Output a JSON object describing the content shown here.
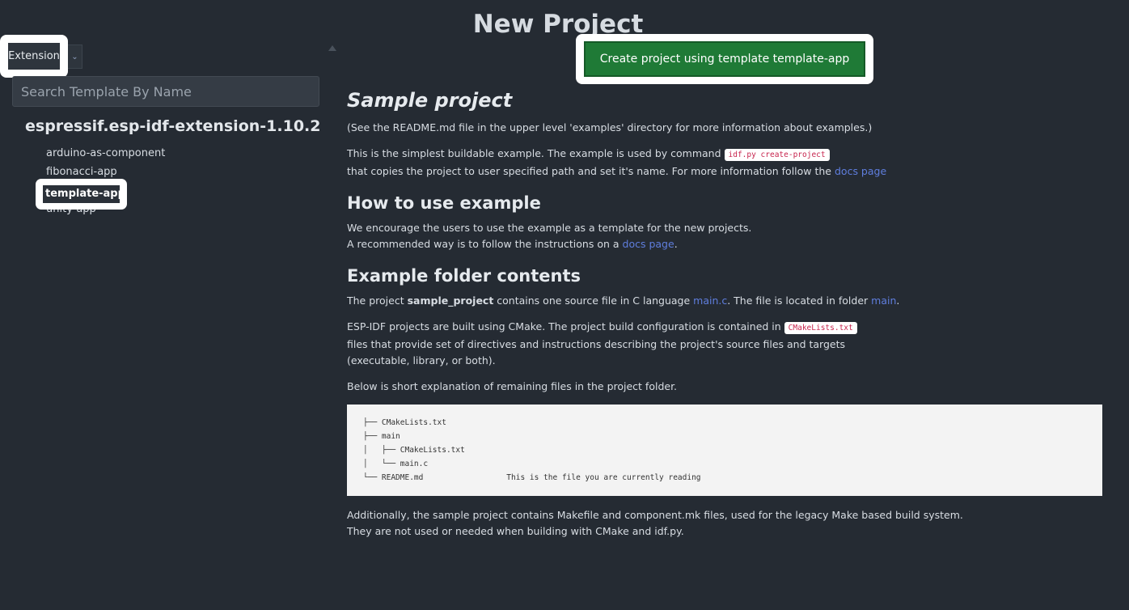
{
  "title": "New Project",
  "source_select": {
    "value": "Extension"
  },
  "search": {
    "placeholder": "Search Template By Name"
  },
  "group": "espressif.esp-idf-extension-1.10.2",
  "templates": [
    "arduino-as-component",
    "fibonacci-app",
    "template-app",
    "unity-app"
  ],
  "create_button": "Create project using template template-app",
  "readme": {
    "h1": "Sample project",
    "p1": "(See the README.md file in the upper level 'examples' directory for more information about examples.)",
    "p2a": "This is the simplest buildable example. The example is used by command ",
    "p2_code": "idf.py create-project",
    "p2b": "that copies the project to user specified path and set it's name. For more information follow the ",
    "p2_link": "docs page",
    "h2a": "How to use example",
    "p3a": "We encourage the users to use the example as a template for the new projects.",
    "p3b": "A recommended way is to follow the instructions on a ",
    "p3_link": "docs page",
    "p3_end": ".",
    "h2b": "Example folder contents",
    "p4a": "The project ",
    "p4_bold": "sample_project",
    "p4b": " contains one source file in C language ",
    "p4_link1": "main.c",
    "p4c": ". The file is located in folder ",
    "p4_link2": "main",
    "p4_end": ".",
    "p5a": "ESP-IDF projects are built using CMake. The project build configuration is contained in ",
    "p5_code": "CMakeLists.txt",
    "p5b": "files that provide set of directives and instructions describing the project's source files and targets",
    "p5c": "(executable, library, or both).",
    "p6": "Below is short explanation of remaining files in the project folder.",
    "tree": "├── CMakeLists.txt\n├── main\n│   ├── CMakeLists.txt\n│   └── main.c\n└── README.md                  This is the file you are currently reading",
    "p7a": "Additionally, the sample project contains Makefile and component.mk files, used for the legacy Make based build system.",
    "p7b": "They are not used or needed when building with CMake and idf.py."
  }
}
